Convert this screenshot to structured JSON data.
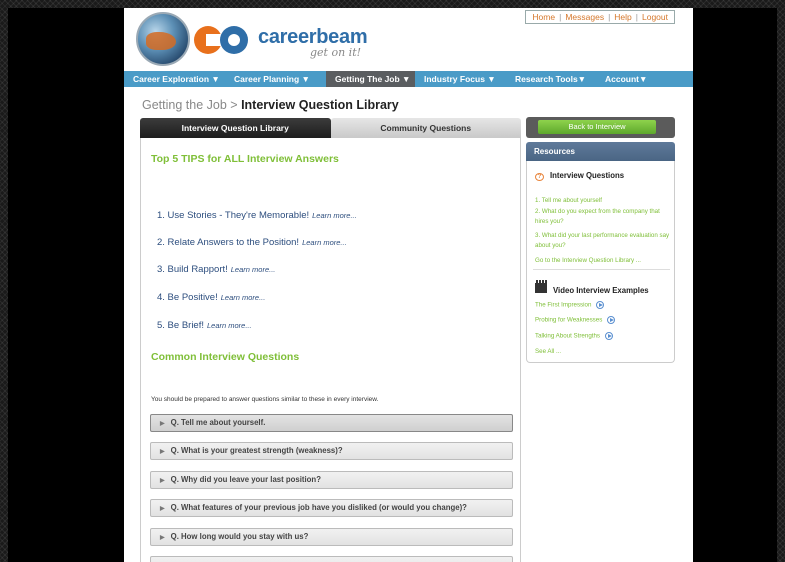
{
  "header": {
    "logo_text": "careerbeam",
    "logo_tagline": "get on it!",
    "top_links": [
      "Home",
      "Messages",
      "Help",
      "Logout"
    ]
  },
  "nav": {
    "items": [
      {
        "label": "Career Exploration ▼",
        "active": false
      },
      {
        "label": "Career Planning ▼",
        "active": false
      },
      {
        "label": "Getting The Job ▼",
        "active": true
      },
      {
        "label": "Industry Focus ▼",
        "active": false
      },
      {
        "label": "Research Tools▼",
        "active": false
      },
      {
        "label": "Account▼",
        "active": false
      }
    ]
  },
  "breadcrumb": {
    "parent": "Getting the Job",
    "separator": ">",
    "current": "Interview Question Library"
  },
  "tabs": [
    {
      "label": "Interview Question Library",
      "active": true
    },
    {
      "label": "Community Questions",
      "active": false
    }
  ],
  "main": {
    "tips_title": "Top 5 TIPS for ALL Interview Answers",
    "tips": [
      {
        "text": "1. Use Stories - They're Memorable!",
        "more": "Learn more..."
      },
      {
        "text": "2. Relate Answers to the Position!",
        "more": "Learn more..."
      },
      {
        "text": "3. Build Rapport!",
        "more": "Learn more..."
      },
      {
        "text": "4. Be Positive!",
        "more": "Learn more..."
      },
      {
        "text": "5. Be Brief!",
        "more": "Learn more..."
      }
    ],
    "common_title": "Common Interview Questions",
    "intro": "You should be prepared to answer questions similar to these in every interview.",
    "questions": [
      "Q. Tell me about yourself.",
      "Q. What is your greatest strength (weakness)?",
      "Q. Why did you leave your last position?",
      "Q. What features of your previous job have you disliked (or would you change)?",
      "Q. How long would you stay with us?"
    ]
  },
  "sidebar": {
    "back_button": "Back to Interview",
    "resources_header": "Resources",
    "interview_questions_title": "Interview Questions",
    "interview_links": [
      "1. Tell me about yourself",
      "2. What do you expect from the company that hires you?",
      "3. What did your last performance evaluation say about you?",
      "Go to the Interview Question Library ..."
    ],
    "video_title": "Video Interview Examples",
    "video_links": [
      "The First Impression",
      "Probing for Weaknesses",
      "Talking About Strengths"
    ],
    "see_all": "See All ..."
  },
  "colors": {
    "nav_blue": "#4a9bc7",
    "green_accent": "#7fbf38",
    "tip_blue": "#2d4e7e",
    "orange_link": "#d5782c"
  }
}
